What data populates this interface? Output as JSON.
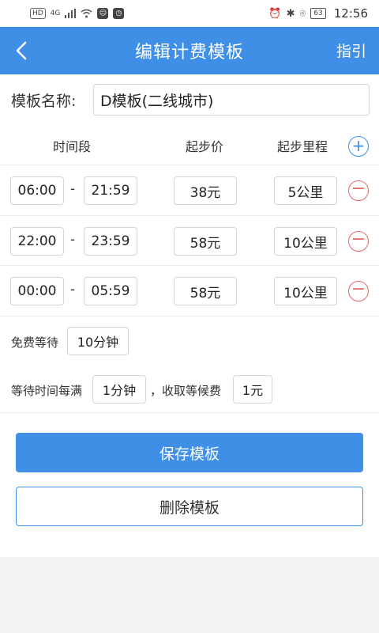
{
  "status_bar": {
    "left_icons": [
      "HD",
      "4G",
      "signal-icon",
      "wifi-icon",
      "app-icon",
      "notification-icon"
    ],
    "battery": "63",
    "time": "12:56"
  },
  "app_bar": {
    "title": "编辑计费模板",
    "right_action": "指引"
  },
  "template": {
    "name_label": "模板名称:",
    "name_value": "D模板(二线城市)"
  },
  "table_headers": {
    "period": "时间段",
    "start_price": "起步价",
    "start_distance": "起步里程"
  },
  "rules": [
    {
      "start": "06:00",
      "sep": "-",
      "end": "21:59",
      "price": "38元",
      "distance": "5公里"
    },
    {
      "start": "22:00",
      "sep": "-",
      "end": "23:59",
      "price": "58元",
      "distance": "10公里"
    },
    {
      "start": "00:00",
      "sep": "-",
      "end": "05:59",
      "price": "58元",
      "distance": "10公里"
    }
  ],
  "free_wait": {
    "label": "免费等待",
    "value": "10分钟"
  },
  "wait_fee": {
    "label1": "等待时间每满",
    "interval": "1分钟",
    "label2": "，收取等候费",
    "fee": "1元"
  },
  "buttons": {
    "save": "保存模板",
    "delete": "删除模板"
  },
  "colors": {
    "primary": "#3f8fe6",
    "danger": "#e06a6a",
    "background": "#f2f2f2"
  }
}
